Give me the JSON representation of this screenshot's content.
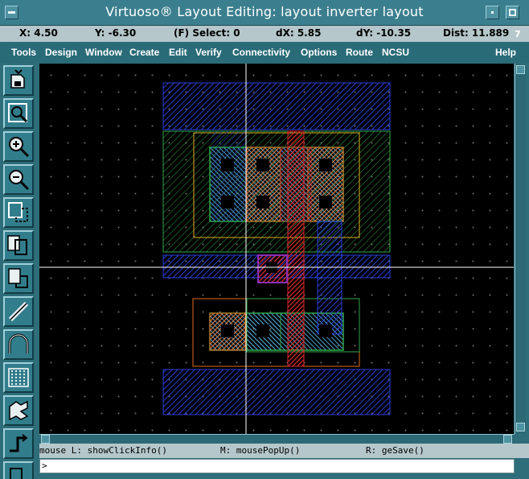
{
  "window": {
    "title": "Virtuoso® Layout Editing: layout inverter layout",
    "corner_number": "7"
  },
  "coords": {
    "x": "X:  4.50",
    "y": "Y: -6.30",
    "select": "(F) Select: 0",
    "dx": "dX:  5.85",
    "dy": "dY: -10.35",
    "dist": "Dist: 11.889"
  },
  "menu": {
    "tools": "Tools",
    "design": "Design",
    "window": "Window",
    "create": "Create",
    "edit": "Edit",
    "verify": "Verify",
    "connectivity": "Connectivity",
    "options": "Options",
    "route": "Route",
    "ncsu": "NCSU",
    "help": "Help"
  },
  "toolbar_icons": [
    "save-icon",
    "fit-view-icon",
    "zoom-in-icon",
    "zoom-out-icon",
    "stretch-icon",
    "copy-icon",
    "move-icon",
    "path-icon",
    "bend-icon",
    "instance-icon",
    "pins-icon",
    "route-icon",
    "undo-icon"
  ],
  "status": {
    "left": "mouse L: showClickInfo()",
    "middle": "M: mousePopUp()",
    "right": "R: geSave()"
  },
  "command": {
    "prompt": ">"
  },
  "colors": {
    "metal1": "#1f2fb8",
    "nwell": "#2fa64a",
    "active": "#3a7fa8",
    "pselect": "#e06a1c",
    "poly": "#d8262a",
    "contact": "#000000",
    "via": "#8a2fb8",
    "crosshair": "#ffffff"
  }
}
